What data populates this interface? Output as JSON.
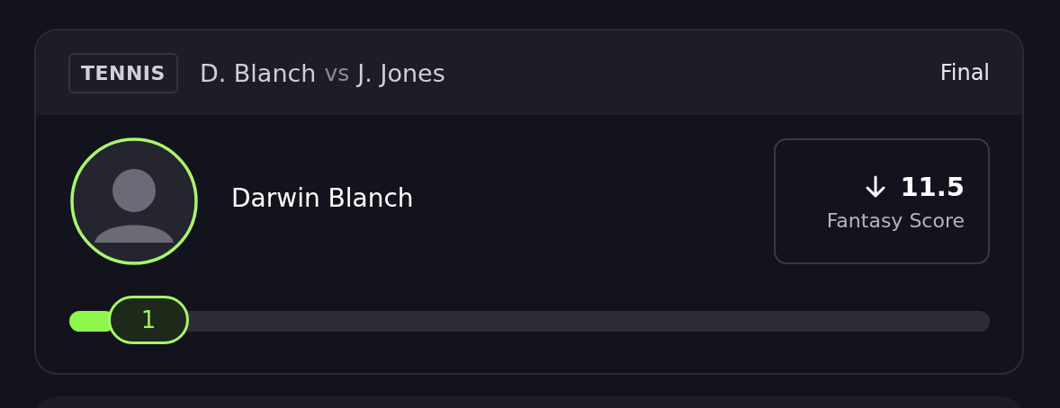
{
  "card": {
    "sport": "TENNIS",
    "player_a": "D. Blanch",
    "vs": "vs",
    "player_b": "J. Jones",
    "status": "Final"
  },
  "player": {
    "name": "Darwin Blanch"
  },
  "score": {
    "kind": "down",
    "value": "11.5",
    "label": "Fantasy Score"
  },
  "progress": {
    "level": 0.05,
    "marker": "1"
  }
}
